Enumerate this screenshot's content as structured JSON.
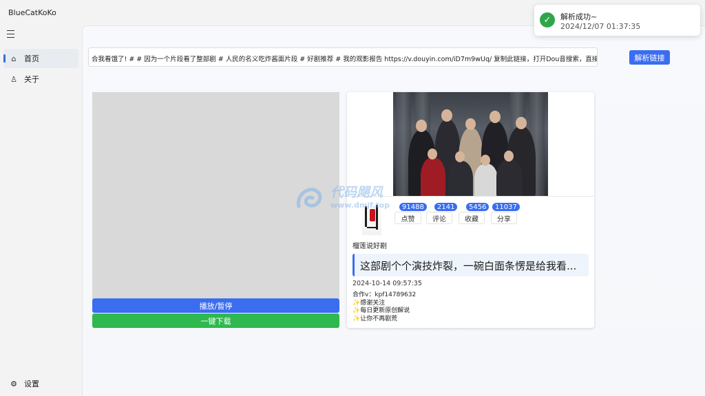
{
  "app": {
    "title": "BlueCatKoKo"
  },
  "nav": {
    "items": [
      {
        "label": "首页",
        "icon": "home-icon",
        "active": true
      },
      {
        "label": "关于",
        "icon": "person-icon",
        "active": false
      }
    ],
    "settings_label": "设置"
  },
  "main": {
    "url_input_value": "合我看饿了! # # 因为一个片段看了整部剧 # 人民的名义吃炸酱面片段 # 好剧推荐 # 我的观影报告  https://v.douyin.com/iD7m9wUq/ 复制此链接，打开Dou音搜索，直接观看视频!",
    "parse_button": "解析链接",
    "play_button": "播放/暂停",
    "download_button": "一键下载"
  },
  "video": {
    "stats": [
      {
        "count": "91488",
        "label": "点赞"
      },
      {
        "count": "2141",
        "label": "评论"
      },
      {
        "count": "5456",
        "label": "收藏"
      },
      {
        "count": "11037",
        "label": "分享"
      }
    ],
    "author": "榴莲说好剧",
    "description": "这部剧个个演技炸裂，一碗白面条愣是给我看...",
    "date": "2024-10-14 09:57:35",
    "lines": [
      "合作v：kpf14789632",
      "✨感谢关注",
      "✨每日更新原创解说",
      "✨让你不再剧荒"
    ]
  },
  "watermark": {
    "text": "代码飓风",
    "sub": "www.dmjf.top"
  },
  "toast": {
    "title": "解析成功~",
    "time": "2024/12/07 01:37:35"
  },
  "colors": {
    "accent": "#3a6df0",
    "success": "#2fb84e"
  }
}
